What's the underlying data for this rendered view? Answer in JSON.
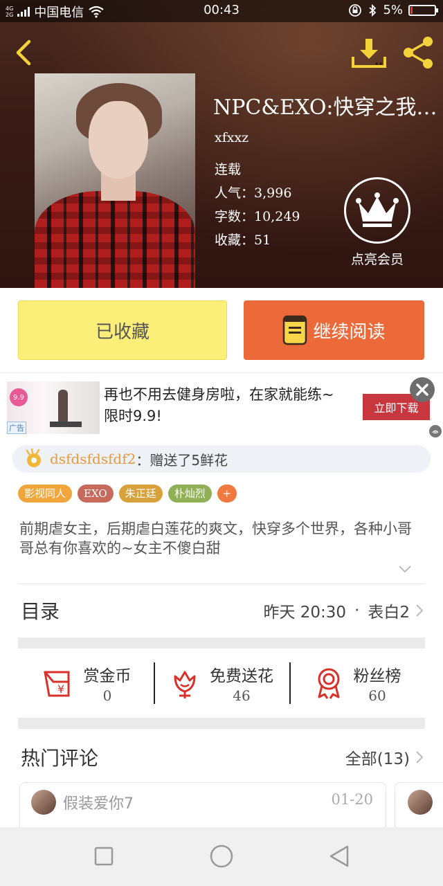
{
  "status_bar": {
    "net_top": "4G",
    "net_bottom": "2G",
    "carrier": "中国电信",
    "time": "00:43",
    "battery": "5%"
  },
  "book": {
    "title": "NPC&EXO:快穿之我…",
    "author": "xfxxz",
    "status": "连载",
    "popularity_label": "人气：",
    "popularity": "3,996",
    "words_label": "字数：",
    "words": "10,249",
    "favorites_label": "收藏：",
    "favorites": "51",
    "vip_label": "点亮会员"
  },
  "actions": {
    "favorited_label": "已收藏",
    "continue_label": "继续阅读"
  },
  "ad": {
    "thumb_price": "9.9",
    "badge": "广告",
    "text": "再也不用去健身房啦，在家就能练~限时9.9!",
    "download_label": "立即下载"
  },
  "gift": {
    "user": "dsfdsfdsfdf2",
    "text": "：赠送了5鲜花"
  },
  "tags": [
    {
      "label": "影视同人",
      "color": "#f0a63a"
    },
    {
      "label": "EXO",
      "color": "#c86a5b"
    },
    {
      "label": "朱正廷",
      "color": "#d9a13c"
    },
    {
      "label": "朴灿烈",
      "color": "#8fb054"
    },
    {
      "label": "+",
      "color": "#f0793f"
    }
  ],
  "description": "前期虐女主，后期虐白莲花的爽文，快穿多个世界，各种小哥哥总有你喜欢的~女主不傻白甜",
  "catalog": {
    "title": "目录",
    "updated": "昨天 20:30",
    "separator": "·",
    "latest": "表白2"
  },
  "stats": [
    {
      "label": "赏金币",
      "value": "0",
      "icon": "red-envelope-icon"
    },
    {
      "label": "免费送花",
      "value": "46",
      "icon": "flower-icon"
    },
    {
      "label": "粉丝榜",
      "value": "60",
      "icon": "medal-icon"
    }
  ],
  "comments": {
    "title": "热门评论",
    "all_label": "全部(13)",
    "items": [
      {
        "user": "假装爱你7",
        "date": "01-20"
      }
    ]
  },
  "colors": {
    "accent_orange": "#ec6a3a",
    "favorite_yellow": "#fbef7a",
    "gift_user": "#e59a3d"
  }
}
